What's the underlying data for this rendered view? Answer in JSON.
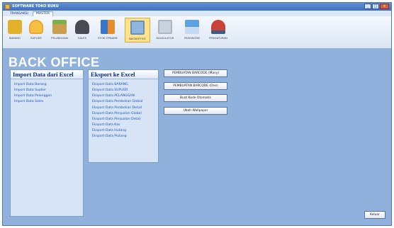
{
  "window": {
    "title": "SOFTWARE TOKO BUKU",
    "controls": [
      "_",
      "□",
      "×"
    ]
  },
  "tabs": [
    "TRANSAKSI",
    "MASTER"
  ],
  "ribbon": [
    {
      "label": "BARANG",
      "icon": "box-icon"
    },
    {
      "label": "SUPLIER",
      "icon": "supplier-icon"
    },
    {
      "label": "PELANGGAN",
      "icon": "customer-icon"
    },
    {
      "label": "SALES",
      "icon": "sales-icon"
    },
    {
      "label": "STOK OPNAME",
      "icon": "stock-icon"
    },
    {
      "label": "BACKOFFICE",
      "icon": "backoffice-icon"
    },
    {
      "label": "KALKULATOR",
      "icon": "calculator-icon"
    },
    {
      "label": "PASSWORD",
      "icon": "password-icon"
    },
    {
      "label": "PENGATURAN",
      "icon": "settings-icon"
    }
  ],
  "header": "BACK OFFICE",
  "import_panel": {
    "title": "Import Data dari Excel",
    "items": [
      "Import Data Barang",
      "Import Data Suplier",
      "Import Data Pelanggan",
      "Import Data Sales"
    ]
  },
  "export_panel": {
    "title": "Eksport ke Excel",
    "items": [
      "Eksport Data BARANG",
      "Eksport Data SUPLIER",
      "Eksport Data PELANGGAN",
      "Eksport Data Pembelian Global",
      "Eksport Data Pembelian Detail",
      "Eksport Data Penjualan Global",
      "Eksport Data Penjualan Detail",
      "Eksport Data Kas",
      "Eksport Data Hutang",
      "Eksport Data Piutang"
    ]
  },
  "buttons": [
    "PEMBUATAN BARCODE (Many)",
    "PEMBUATAN BARCODE (One)",
    "Buat Kode Otomatis",
    "Ubah Wallpaper"
  ],
  "close_button": "Keluar"
}
